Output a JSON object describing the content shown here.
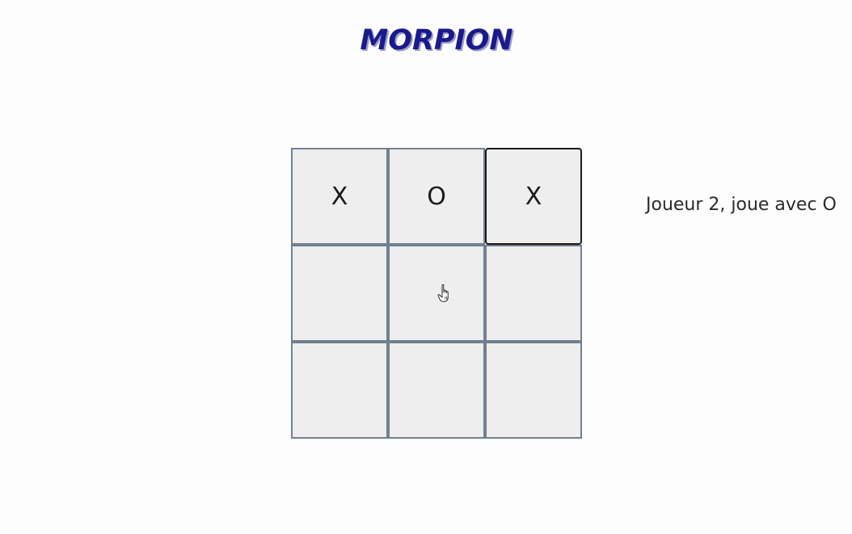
{
  "header": {
    "title": "MORPION"
  },
  "board": {
    "cells": [
      "X",
      "O",
      "X",
      "",
      "",
      "",
      "",
      "",
      ""
    ]
  },
  "status": {
    "text": "Joueur 2, joue avec O"
  },
  "colors": {
    "title": "#1a1a8c",
    "cell_background": "#eeeeee",
    "cell_border": "#718090"
  },
  "icons": {
    "cursor": "hand-pointer-icon"
  }
}
